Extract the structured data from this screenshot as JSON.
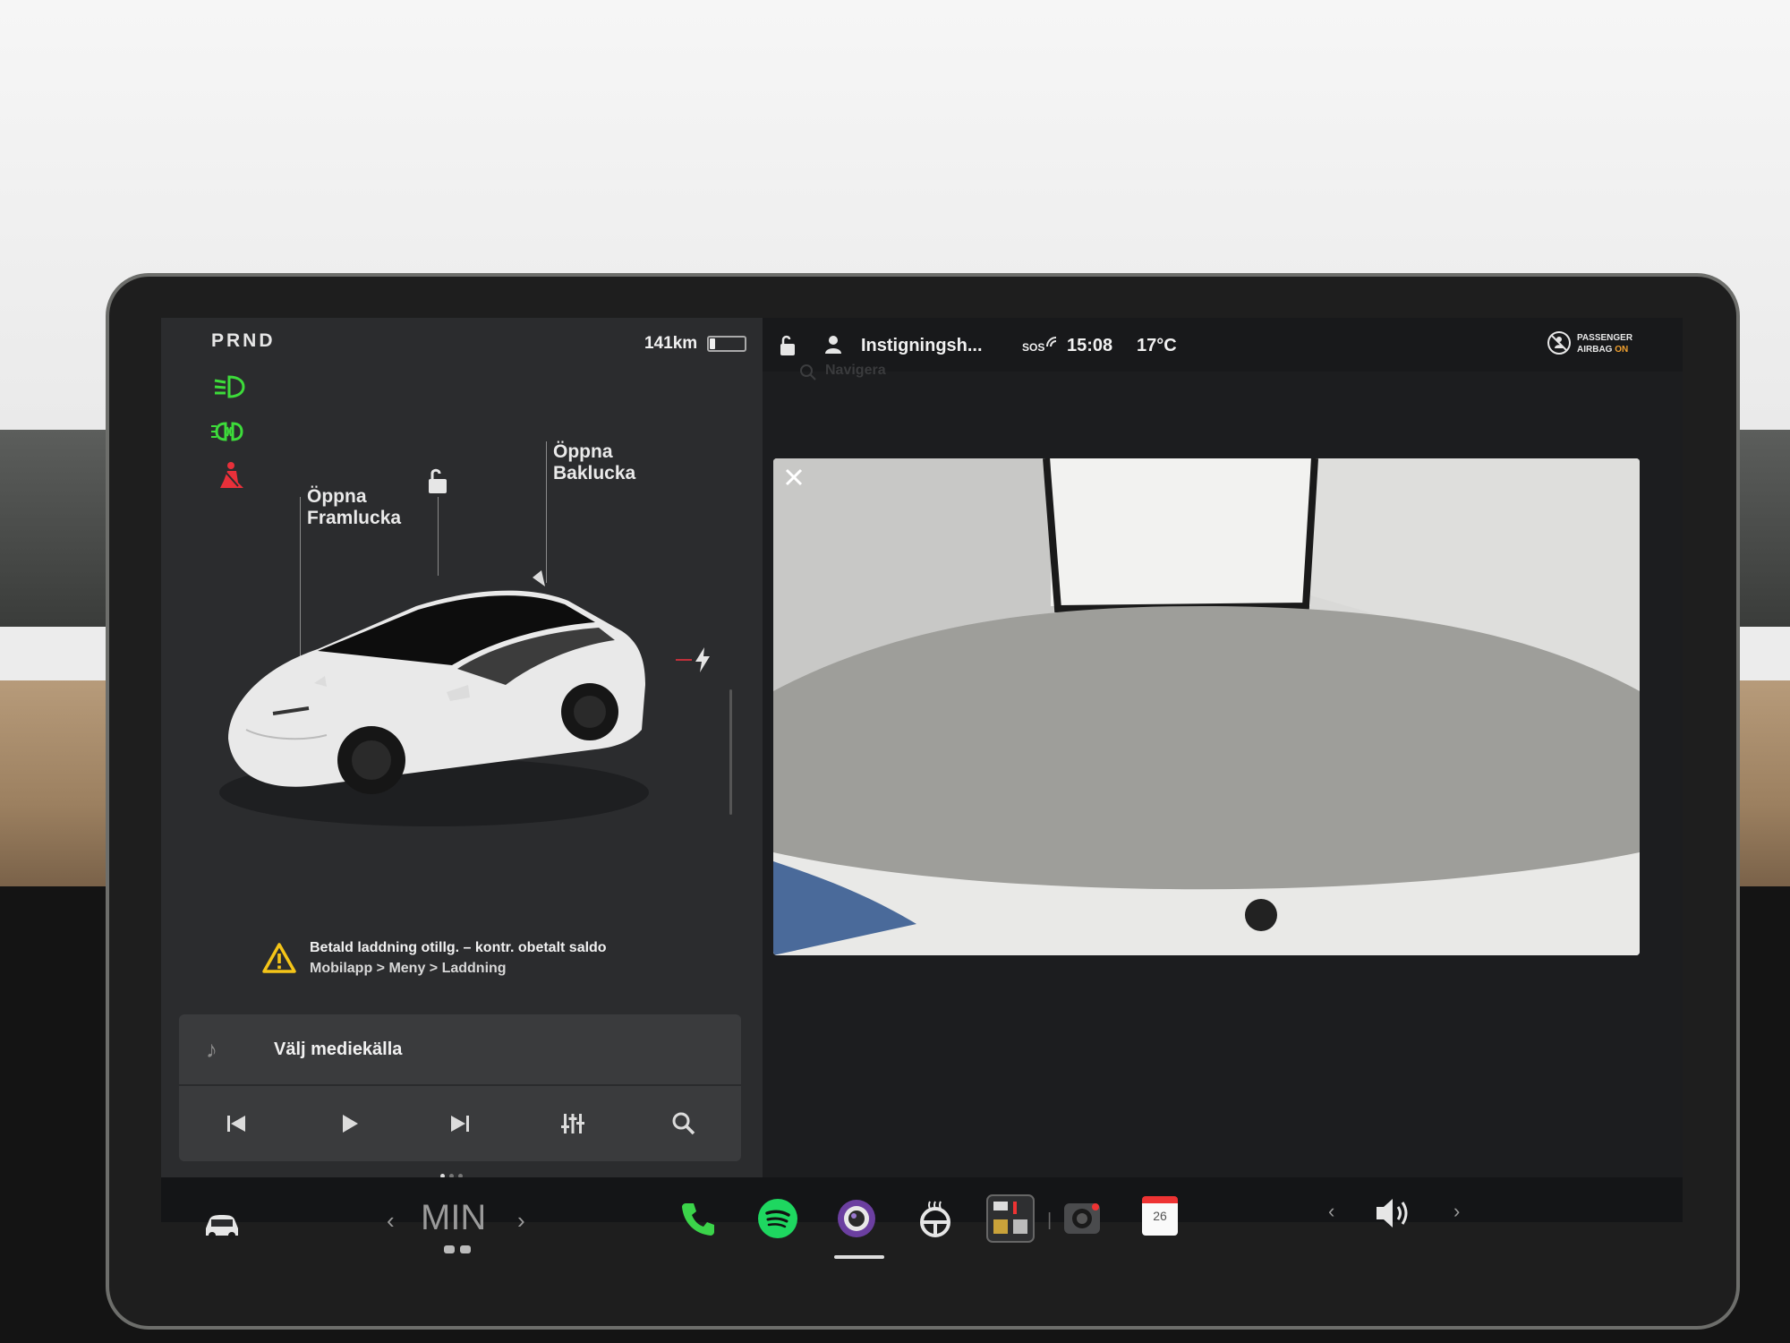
{
  "gear": "PRND",
  "range": "141km",
  "battery_level": 0.15,
  "status": {
    "profile": "Instigningsh...",
    "sos": "SOS",
    "time": "15:08",
    "temperature": "17°C",
    "airbag_line1": "PASSENGER",
    "airbag_line2": "AIRBAG",
    "airbag_state": "ON"
  },
  "navigation": {
    "placeholder": "Navigera"
  },
  "car": {
    "frunk_callout": "Öppna\nFramlucka",
    "trunk_callout": "Öppna\nBaklucka"
  },
  "alert": {
    "line1": "Betald laddning otillg. – kontr. obetalt saldo",
    "line2": "Mobilapp > Meny > Laddning"
  },
  "media": {
    "source_label": "Välj mediekälla"
  },
  "dock": {
    "climate_label": "MIN",
    "calendar_day": "26"
  },
  "icons": {
    "low_beam": "low-beam-icon",
    "fog_lights": "fog-light-icon",
    "seatbelt": "seatbelt-warning-icon",
    "lock": "unlock-icon",
    "profile": "person-icon",
    "close": "close-icon",
    "phone": "phone-icon",
    "spotify": "spotify-icon",
    "camera_app": "camera-icon",
    "steering_heat": "steering-wheel-heat-icon",
    "apps": "app-launcher-icon",
    "dashcam": "dashcam-icon",
    "calendar": "calendar-icon",
    "volume": "volume-icon",
    "car_home": "car-icon"
  },
  "colors": {
    "light_green": "#3ddc3a",
    "seatbelt_red": "#e8303a",
    "phone_green": "#3bd44a",
    "spotify_green": "#1ed760",
    "airbag_on": "#f0a030",
    "warning_yellow": "#f5c518"
  }
}
